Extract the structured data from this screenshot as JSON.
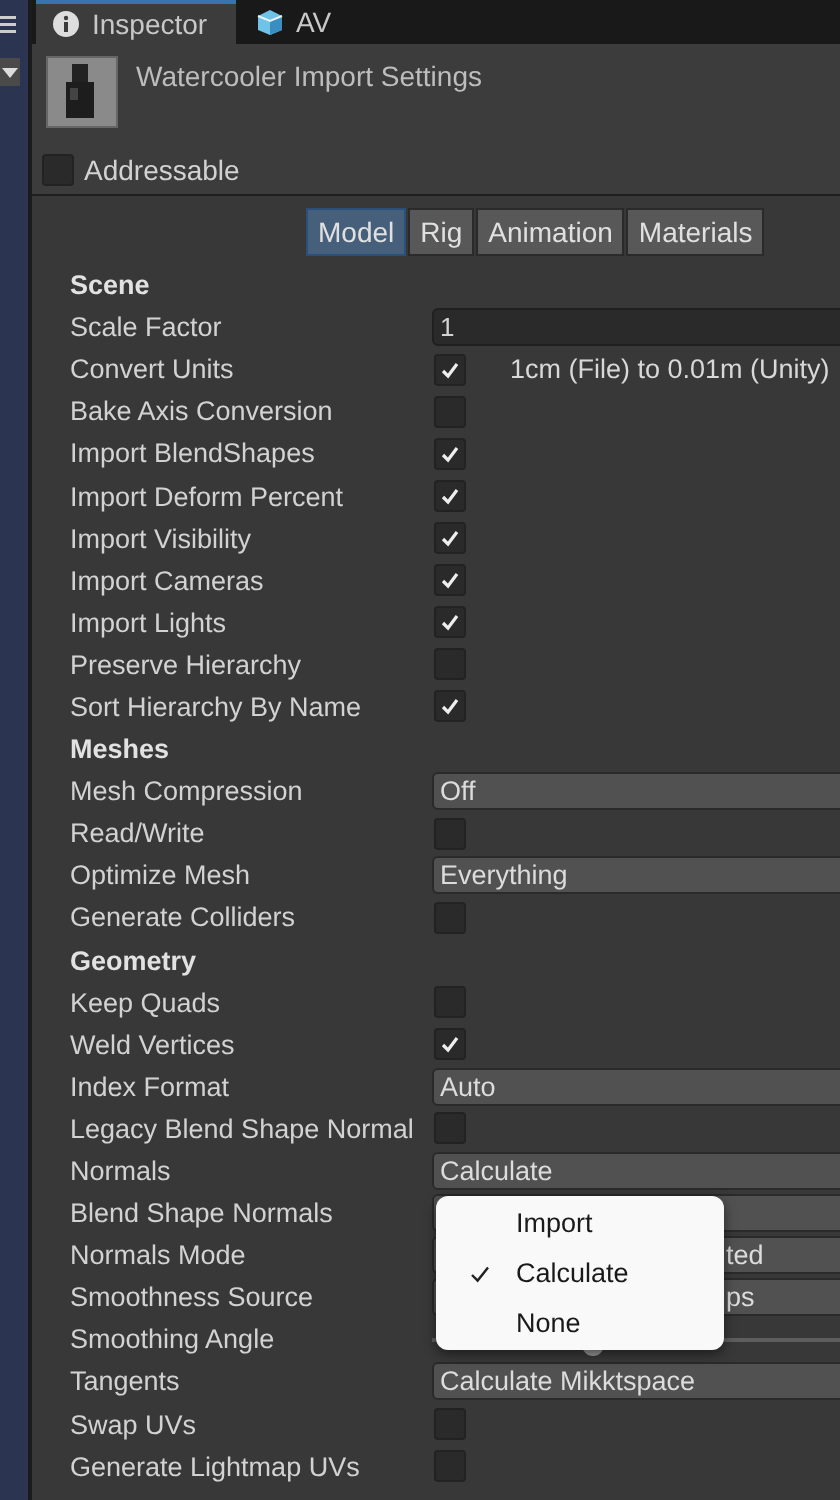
{
  "tabs": [
    {
      "label": "Inspector",
      "kind": "info",
      "selected": true
    },
    {
      "label": "AV",
      "kind": "package",
      "selected": false
    }
  ],
  "header": {
    "title": "Watercooler Import Settings",
    "addressable": {
      "label": "Addressable",
      "checked": false
    }
  },
  "sub_tabs": [
    {
      "label": "Model",
      "selected": true
    },
    {
      "label": "Rig",
      "selected": false
    },
    {
      "label": "Animation",
      "selected": false
    },
    {
      "label": "Materials",
      "selected": false
    }
  ],
  "rows": [
    {
      "kind": "section",
      "label": "Scene"
    },
    {
      "kind": "text",
      "label": "Scale Factor",
      "value": "1"
    },
    {
      "kind": "checkbox",
      "label": "Convert Units",
      "checked": true,
      "note": "1cm (File) to 0.01m (Unity)"
    },
    {
      "kind": "checkbox",
      "label": "Bake Axis Conversion",
      "checked": false
    },
    {
      "kind": "checkbox",
      "label": "Import BlendShapes",
      "checked": true
    },
    {
      "kind": "checkbox",
      "label": "Import Deform Percent",
      "checked": true
    },
    {
      "kind": "checkbox",
      "label": "Import Visibility",
      "checked": true
    },
    {
      "kind": "checkbox",
      "label": "Import Cameras",
      "checked": true
    },
    {
      "kind": "checkbox",
      "label": "Import Lights",
      "checked": true
    },
    {
      "kind": "checkbox",
      "label": "Preserve Hierarchy",
      "checked": false
    },
    {
      "kind": "checkbox",
      "label": "Sort Hierarchy By Name",
      "checked": true
    },
    {
      "kind": "section",
      "label": "Meshes"
    },
    {
      "kind": "dropdown",
      "label": "Mesh Compression",
      "value": "Off",
      "covered": false
    },
    {
      "kind": "checkbox",
      "label": "Read/Write",
      "checked": false
    },
    {
      "kind": "dropdown",
      "label": "Optimize Mesh",
      "value": "Everything",
      "covered": false
    },
    {
      "kind": "checkbox",
      "label": "Generate Colliders",
      "checked": false
    },
    {
      "kind": "section",
      "label": "Geometry"
    },
    {
      "kind": "checkbox",
      "label": "Keep Quads",
      "checked": false
    },
    {
      "kind": "checkbox",
      "label": "Weld Vertices",
      "checked": true
    },
    {
      "kind": "dropdown",
      "label": "Index Format",
      "value": "Auto",
      "covered": false
    },
    {
      "kind": "checkbox",
      "label": "Legacy Blend Shape Normal",
      "checked": false
    },
    {
      "kind": "dropdown",
      "label": "Normals",
      "value": "Calculate",
      "covered": false
    },
    {
      "kind": "dropdown",
      "label": "Blend Shape Normals",
      "covered": true
    },
    {
      "kind": "dropdown",
      "label": "Normals Mode",
      "value": "ted",
      "covered": true
    },
    {
      "kind": "dropdown",
      "label": "Smoothness Source",
      "value": "ps",
      "covered": true
    },
    {
      "kind": "slider",
      "label": "Smoothing Angle",
      "level": 0.38
    },
    {
      "kind": "dropdown",
      "label": "Tangents",
      "value": "Calculate Mikktspace",
      "covered": false
    },
    {
      "kind": "checkbox",
      "label": "Swap UVs",
      "checked": false
    },
    {
      "kind": "checkbox",
      "label": "Generate Lightmap UVs",
      "checked": false
    }
  ],
  "popup_menu": {
    "items": [
      {
        "label": "Import",
        "selected": false
      },
      {
        "label": "Calculate",
        "selected": true
      },
      {
        "label": "None",
        "selected": false
      }
    ]
  }
}
